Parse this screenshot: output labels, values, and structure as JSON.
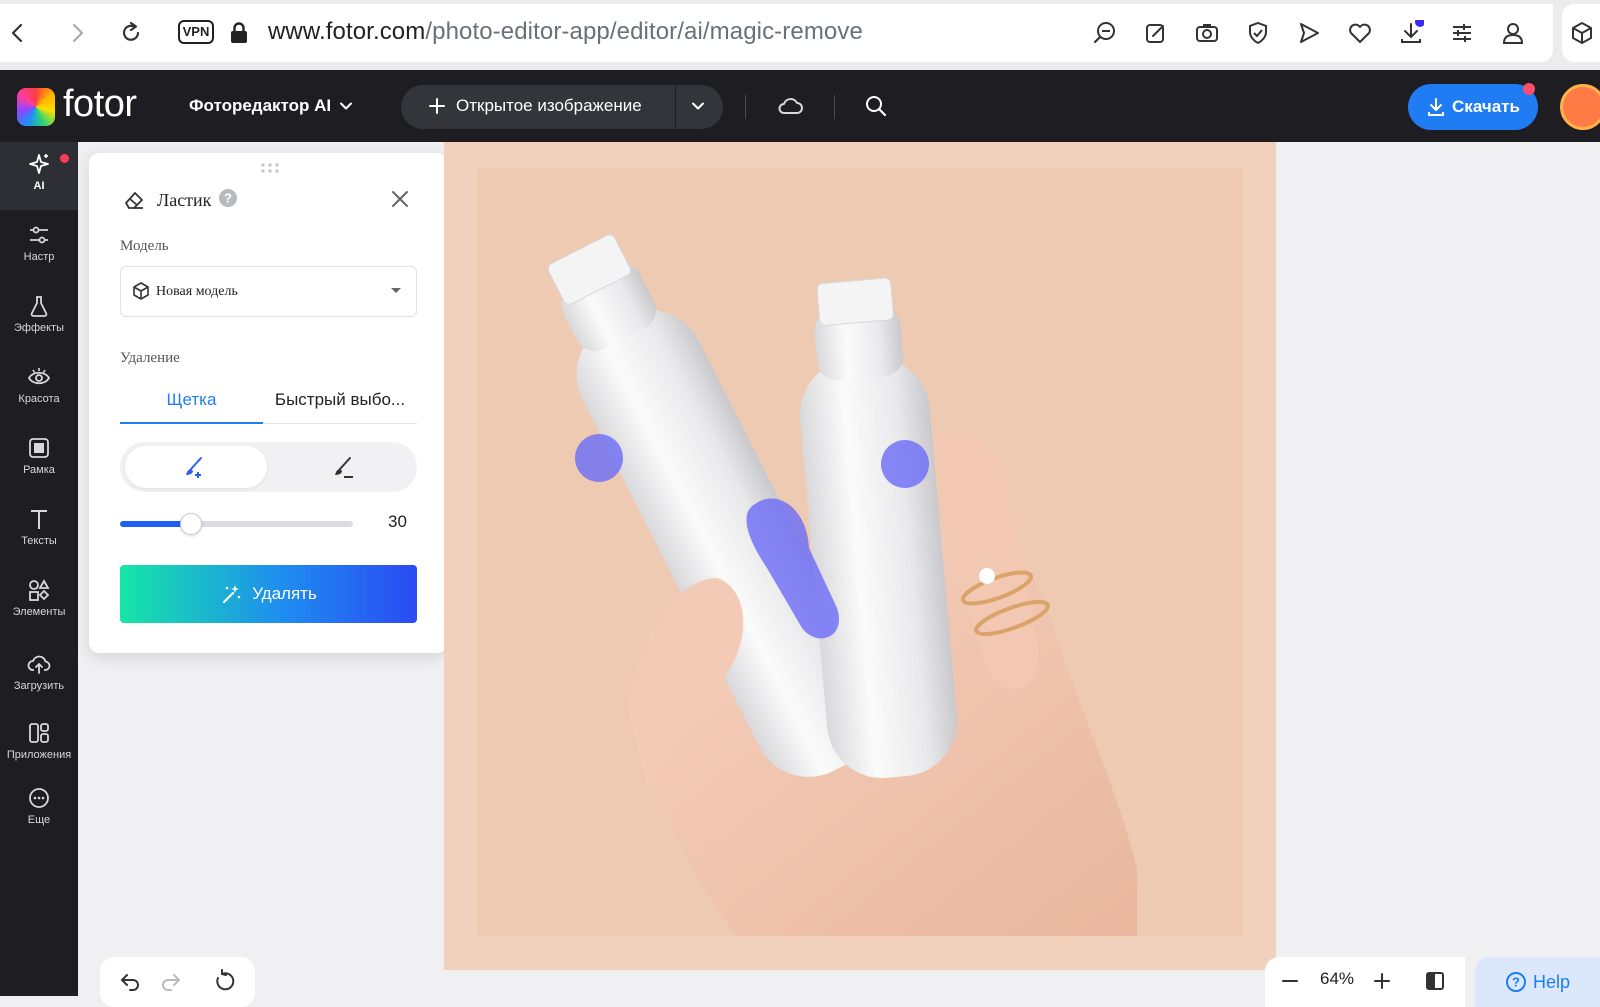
{
  "browser": {
    "url_host": "www.fotor.com",
    "url_path": "/photo-editor-app/editor/ai/magic-remove",
    "vpn_label": "VPN"
  },
  "header": {
    "logo_text": "fotor",
    "editor_menu": "Фоторедактор AI",
    "open_image": "Открытое изображение",
    "download": "Скачать"
  },
  "rail": {
    "items": [
      {
        "label": "AI",
        "icon": "sparkle-icon"
      },
      {
        "label": "Настр",
        "icon": "sliders-icon"
      },
      {
        "label": "Эффекты",
        "icon": "flask-icon"
      },
      {
        "label": "Красота",
        "icon": "eye-icon"
      },
      {
        "label": "Рамка",
        "icon": "frame-icon"
      },
      {
        "label": "Тексты",
        "icon": "text-icon"
      },
      {
        "label": "Элементы",
        "icon": "shapes-icon"
      },
      {
        "label": "Загрузить",
        "icon": "upload-cloud-icon"
      },
      {
        "label": "Приложения",
        "icon": "apps-icon"
      },
      {
        "label": "Еще",
        "icon": "more-icon"
      }
    ]
  },
  "panel": {
    "title": "Ластик",
    "model_label": "Модель",
    "model_value": "Новая модель",
    "removal_label": "Удаление",
    "tab_brush": "Щетка",
    "tab_quick": "Быстрый выбо...",
    "brush_size": 30,
    "brush_size_max": 100,
    "remove_button": "Удалять"
  },
  "zoom": {
    "level": "64%"
  },
  "help": {
    "label": "Help"
  },
  "colors": {
    "accent": "#1f7cf2",
    "header_bg": "#1d1d22",
    "brush_mark": "#6e6ef6"
  }
}
